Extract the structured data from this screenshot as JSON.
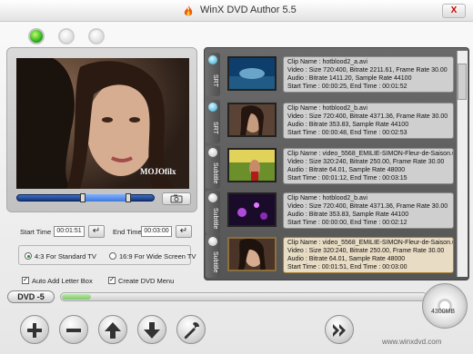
{
  "window": {
    "title": "WinX DVD Author 5.5",
    "close_label": "X"
  },
  "preview": {
    "watermark": "MOJOfilx"
  },
  "trim": {
    "start_label": "Start Time :",
    "start_value": "00:01:51",
    "end_label": "End Time :",
    "end_value": "00:03:00"
  },
  "aspect": {
    "option1": "4:3 For Standard TV",
    "option2": "16:9 For Wide Screen TV",
    "selected": "4:3 For Standard TV"
  },
  "options": {
    "letterbox_label": "Auto Add Letter Box",
    "letterbox_checked": true,
    "menu_label": "Create DVD Menu",
    "menu_checked": true
  },
  "clips": [
    {
      "tab": "SRT",
      "tab_active": true,
      "name": "Clip Name : hotblood2_a.avi",
      "video": "Video : Size 720:400, Bitrate 2211.61, Frame Rate 30.00",
      "audio": "Audio : Bitrate 1411.20, Sample Rate 44100",
      "time": "Start Time : 00:00:25, End Time : 00:01:52"
    },
    {
      "tab": "SRT",
      "tab_active": true,
      "name": "Clip Name : hotblood2_b.avi",
      "video": "Video : Size 720:400, Bitrate 4371.36, Frame Rate 30.00",
      "audio": "Audio : Bitrate 353.83, Sample Rate 44100",
      "time": "Start Time : 00:00:48, End Time : 00:02:53"
    },
    {
      "tab": "Subtitle",
      "tab_active": false,
      "name": "Clip Name : video_5568_EMILIE-SIMON-Fleur-de-Saison.w",
      "video": "Video : Size 320:240, Bitrate 250.00, Frame Rate 30.00",
      "audio": "Audio : Bitrate 64.01, Sample Rate 48000",
      "time": "Start Time : 00:01:12, End Time : 00:03:15"
    },
    {
      "tab": "Subtitle",
      "tab_active": false,
      "name": "Clip Name : hotblood2_b.avi",
      "video": "Video : Size 720:400, Bitrate 4371.36, Frame Rate 30.00",
      "audio": "Audio : Bitrate 353.83, Sample Rate 44100",
      "time": "Start Time : 00:00:00, End Time : 00:02:12"
    },
    {
      "tab": "Subtitle",
      "tab_active": false,
      "name": "Clip Name : video_5568_EMILIE-SIMON-Fleur-de-Saison.w",
      "video": "Video : Size 320:240, Bitrate 250.00, Frame Rate 30.00",
      "audio": "Audio : Bitrate 64.01, Sample Rate 48000",
      "time": "Start Time : 00:01:51, End Time : 00:03:00"
    }
  ],
  "disc": {
    "type": "DVD -5",
    "capacity": "4300MB",
    "used_fraction": 0.08
  },
  "footer": {
    "site": "www.winxdvd.com"
  },
  "colors": {
    "accent_green": "#1ea413",
    "selected_row": "#e8dcc4",
    "seek_blue": "#1f4fa8"
  }
}
